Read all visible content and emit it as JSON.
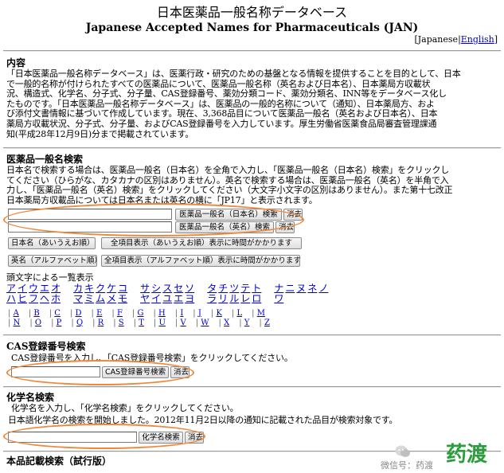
{
  "header": {
    "title_jp": "日本医薬品一般名称データベース",
    "title_en": "Japanese Accepted Names for Pharmaceuticals (JAN)",
    "lang_open": "[",
    "lang_current": "Japanese",
    "lang_sep": "|",
    "lang_english": "English",
    "lang_close": "]"
  },
  "intro": {
    "heading": "内容",
    "lines": [
      "「日本医薬品一般名称データベース」は、医薬行政・研究のための基盤となる情報を提供することを目的として、日本",
      "で一般的名称が付けられたすべての医薬品について、医薬品一般名称（英名および日本名）、日本薬局方収載状",
      "況、構造式、化学名、分子式、分子量、CAS登録番号、薬効分類コード、薬効分類名、INN等をデータベース化し",
      "たものです。「日本医薬品一般名称データベース」は、医薬品の一般的名称について（通知）、日本薬局方、およ",
      "び添付文書情報に基づいて作成しています。現在、3,368品目について医薬品一般名（英名および日本名）、日本",
      "薬局方収載状況、分子式、分子量、およびCAS登録番号を入力しています。厚生労働省医薬食品局審査管理課通",
      "知(平成28年12月9日)分まで掲載されています。"
    ]
  },
  "name_search": {
    "heading": "医薬品一般名検索",
    "lines": [
      "日本名で検索する場合は、医薬品一般名（日本名）を全角で入力し、「医薬品一般名（日本名）検索」をクリックし",
      "てください（ひらがな、カタカナの区別はありません）。英名で検索する場合は、医薬品一般名（英名）を半角で入",
      "力し、「医薬品一般名（英名）検索」をクリックしてください（大文字小文字の区別はありません）。また第十七改正",
      "日本薬局方収載品については日本名または英名の横に「JP17」と表示されます。"
    ],
    "jp_input_value": "",
    "en_input_value": "",
    "jp_search_label": "医薬品一般名（日本名）検索",
    "en_search_label": "医薬品一般名（英名）検索",
    "clear_label": "消去",
    "btn_jp_list": "日本名（あいうえお順）",
    "btn_jp_all": "全項目表示（あいうえお順）表示に時間がかかります",
    "btn_en_list": "英名（アルファベット順）",
    "btn_en_all": "全項目表示（アルファベット順）表示に時間がかかります",
    "index_label": "頭文字による一覧表示",
    "kana_row1": [
      "ア",
      "イ",
      "ウ",
      "エ",
      "オ",
      "カ",
      "キ",
      "ク",
      "ケ",
      "コ",
      "サ",
      "シ",
      "ス",
      "セ",
      "ソ",
      "タ",
      "チ",
      "ツ",
      "テ",
      "ト",
      "ナ",
      "ニ",
      "ヌ",
      "ネ",
      "ノ"
    ],
    "kana_row2": [
      "ハ",
      "ヒ",
      "フ",
      "ヘ",
      "ホ",
      "マ",
      "ミ",
      "ム",
      "メ",
      "モ",
      "ヤ",
      "イ",
      "ユ",
      "エ",
      "ヨ",
      "ラ",
      "リ",
      "ル",
      "レ",
      "ロ",
      "ワ"
    ],
    "alpha_row1": [
      "A",
      "B",
      "C",
      "D",
      "E",
      "F",
      "G",
      "H",
      "I",
      "J",
      "K",
      "L",
      "M"
    ],
    "alpha_row2": [
      "N",
      "O",
      "P",
      "Q",
      "R",
      "S",
      "T",
      "U",
      "V",
      "W",
      "X",
      "Y",
      "Z"
    ]
  },
  "cas_search": {
    "heading": "CAS登録番号検索",
    "line": "CAS登録番号を入力し、「CAS登録番号検索」をクリックしてください。",
    "input_value": "",
    "search_label": "CAS登録番号検索",
    "clear_label": "消去"
  },
  "chem_search": {
    "heading": "化学名検索",
    "line1": "化学名を入力し、「化学名検索」をクリックしてください。",
    "line2": "日本語化学名の検索を開始しました。2012年11月2日以降の通知に記載された品目が検索対象です。",
    "input_value": "",
    "search_label": "化学名検索",
    "clear_label": "消去"
  },
  "trial_search": {
    "heading": "本品記載検索（試行版）"
  },
  "watermark": {
    "small_text": "微信号：药渡",
    "big_text": "药渡"
  },
  "colors": {
    "link": "#0000cc",
    "highlight_oval": "#f0883a",
    "watermark_green": "#2a9d3c"
  }
}
